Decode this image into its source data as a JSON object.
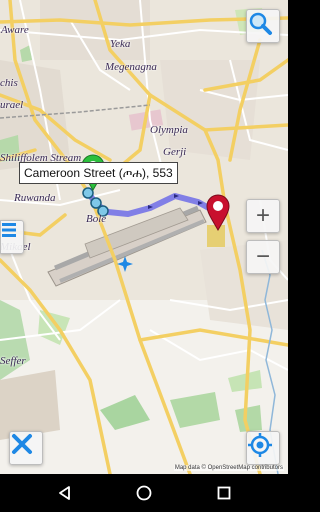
{
  "map": {
    "places": [
      {
        "name": "Aware"
      },
      {
        "name": "Yeka"
      },
      {
        "name": "Megenagna"
      },
      {
        "name": "chis"
      },
      {
        "name": "urael"
      },
      {
        "name": "Shiliffolem Stream"
      },
      {
        "name": "Ruwanda"
      },
      {
        "name": "Bole"
      },
      {
        "name": "Olympia"
      },
      {
        "name": "Gerji"
      },
      {
        "name": "Mikael"
      },
      {
        "name": "Seffer"
      }
    ],
    "tooltip": "Cameroon Street (ጦሐ), 553",
    "attribution": "Map data © OpenStreetMap contributors"
  },
  "controls": {
    "search_icon": "search-icon",
    "zoom_in": "+",
    "zoom_out": "−",
    "layers_icon": "list-icon",
    "close_icon": "close-icon",
    "locate_icon": "gps-target-icon"
  },
  "colors": {
    "route": "#6f6ce8",
    "start_marker": "#2bbf3c",
    "end_marker": "#c8102e",
    "primary_road": "#f6d36b",
    "accent": "#1e88e5"
  },
  "navbar": {
    "back_icon": "back-triangle-icon",
    "home_icon": "home-circle-icon",
    "recents_icon": "recents-square-icon"
  }
}
